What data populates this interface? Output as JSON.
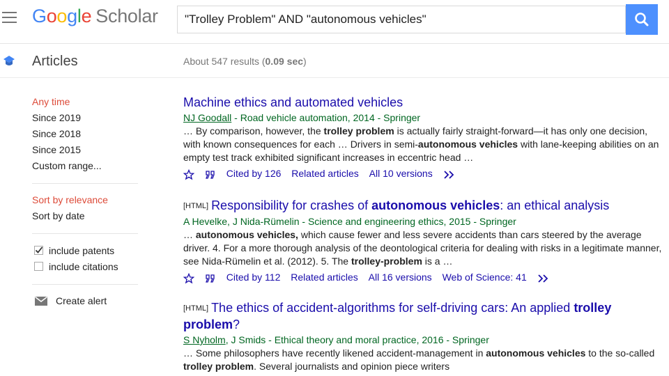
{
  "header": {
    "logo_google": [
      "G",
      "o",
      "o",
      "g",
      "l",
      "e"
    ],
    "logo_scholar": "Scholar",
    "search_value": "\"Trolley Problem\" AND \"autonomous vehicles\""
  },
  "subheader": {
    "section": "Articles",
    "results_prefix": "About 547 results (",
    "results_time": "0.09 sec",
    "results_suffix": ")"
  },
  "sidebar": {
    "time_filters": [
      "Any time",
      "Since 2019",
      "Since 2018",
      "Since 2015",
      "Custom range..."
    ],
    "sort_options": [
      "Sort by relevance",
      "Sort by date"
    ],
    "include_patents": "include patents",
    "include_citations": "include citations",
    "create_alert": "Create alert"
  },
  "results": [
    {
      "title": "Machine ethics and automated vehicles",
      "meta_author": "NJ Goodall",
      "meta_rest": " - Road vehicle automation, 2014 - Springer",
      "snippet": [
        {
          "t": "… By comparison, however, the "
        },
        {
          "b": "trolley problem"
        },
        {
          "t": " is actually fairly straight-forward—it has only one decision, with known consequences for each … Drivers in semi-"
        },
        {
          "b": "autonomous vehicles"
        },
        {
          "t": " with lane-keeping abilities on an empty test track exhibited significant increases in eccentric head …"
        }
      ],
      "actions": [
        "Cited by 126",
        "Related articles",
        "All 10 versions"
      ]
    },
    {
      "tag": "[HTML]",
      "title_parts": [
        {
          "t": "Responsibility for crashes of "
        },
        {
          "b": "autonomous vehicles"
        },
        {
          "t": ": an ethical analysis"
        }
      ],
      "meta_author": "",
      "meta_rest": "A Hevelke, J Nida-Rümelin - Science and engineering ethics, 2015 - Springer",
      "snippet": [
        {
          "t": "… "
        },
        {
          "b": "autonomous vehicles,"
        },
        {
          "t": " which cause fewer and less severe accidents than cars steered by the average driver. 4. For a more thorough analysis of the deontological criteria for dealing with risks in a legitimate manner, see Nida-Rümelin et al. (2012). 5. The "
        },
        {
          "b": "trolley-problem"
        },
        {
          "t": " is a …"
        }
      ],
      "actions": [
        "Cited by 112",
        "Related articles",
        "All 16 versions",
        "Web of Science: 41"
      ]
    },
    {
      "tag": "[HTML]",
      "title_parts": [
        {
          "t": "The ethics of accident-algorithms for self-driving cars: An applied "
        },
        {
          "b": "trolley problem"
        },
        {
          "t": "?"
        }
      ],
      "meta_author": "S Nyholm",
      "meta_rest": ", J Smids - Ethical theory and moral practice, 2016 - Springer",
      "snippet": [
        {
          "t": "… Some philosophers have recently likened accident-management in "
        },
        {
          "b": "autonomous vehicles"
        },
        {
          "t": " to the so-called "
        },
        {
          "b": "trolley problem"
        },
        {
          "t": ". Several journalists and opinion piece writers"
        }
      ],
      "actions": []
    }
  ],
  "colors": {
    "brand_blue": "#4285f4",
    "search_button": "#4d90fe",
    "link": "#1a0dab",
    "meta_green": "#006621",
    "active_filter": "#dd4b39"
  }
}
